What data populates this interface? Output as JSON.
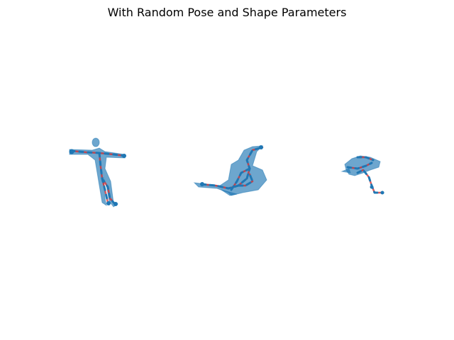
{
  "title": "With Random Pose and Shape Parameters",
  "colors": {
    "mesh": "#1f77b4",
    "skeleton": "#d62728",
    "background": "#ffffff"
  },
  "figures": [
    {
      "name": "t-pose-figure"
    },
    {
      "name": "lying-figure"
    },
    {
      "name": "crouched-figure"
    }
  ]
}
